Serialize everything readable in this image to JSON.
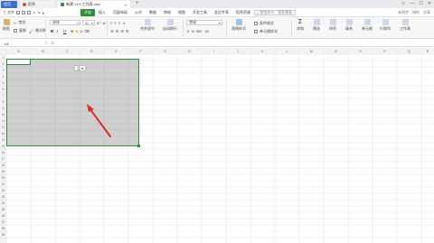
{
  "titlebar": {
    "home_tab": "首页",
    "wps_tab": "稻壳",
    "book_tab": "新建 XLS 工作表.xlsx",
    "add_tab": "+",
    "window_controls": [
      "▭",
      "—",
      "☐",
      "✕"
    ]
  },
  "menubar": {
    "file_label": "三 文件",
    "tabs": [
      "开始",
      "插入",
      "页面布局",
      "公式",
      "数据",
      "审阅",
      "视图",
      "开发工具",
      "会员专享",
      "稻壳资源"
    ],
    "active_tab": "开始",
    "search_placeholder": "查找命令、搜索模板",
    "right_items": [
      "未同步",
      "协作",
      "分享"
    ]
  },
  "ribbon": {
    "paste": "粘贴",
    "cut": "剪切",
    "copy": "复制",
    "format_painter": "格式刷",
    "font_name": "宋体",
    "font_size": "11",
    "bold": "B",
    "italic": "I",
    "underline": "U",
    "merge_center": "合并居中",
    "wrap": "自动换行",
    "number_format": "常规",
    "conditional_format": "条件格式",
    "table_style": "表格样式",
    "cell_style": "单元格样式",
    "sum": "求和",
    "filter": "筛选",
    "sort": "排序",
    "fill": "填充",
    "cell": "单元格",
    "row_col": "行和列",
    "worksheet": "工作表"
  },
  "formula_bar": {
    "name_box": "A1",
    "fx": "fx"
  },
  "sheet": {
    "columns": [
      "A",
      "B",
      "C",
      "D",
      "E",
      "F",
      "G",
      "H",
      "I",
      "J",
      "K",
      "L",
      "M",
      "N",
      "O",
      "P",
      "Q",
      "R"
    ],
    "rows": [
      "1",
      "2",
      "3",
      "4",
      "5",
      "6",
      "7",
      "8",
      "9",
      "10",
      "11",
      "12",
      "13",
      "14",
      "15",
      "16",
      "17",
      "18",
      "19",
      "20",
      "21",
      "22",
      "23",
      "24",
      "25",
      "26",
      "27",
      "28",
      "29",
      "30"
    ],
    "quick_tag": "品 ▾"
  },
  "colors": {
    "accent": "#2f8e3a",
    "home_tab_blue": "#3b6fd4",
    "selection_fill": "#a6a6a6",
    "arrow_red": "#d9302c"
  }
}
